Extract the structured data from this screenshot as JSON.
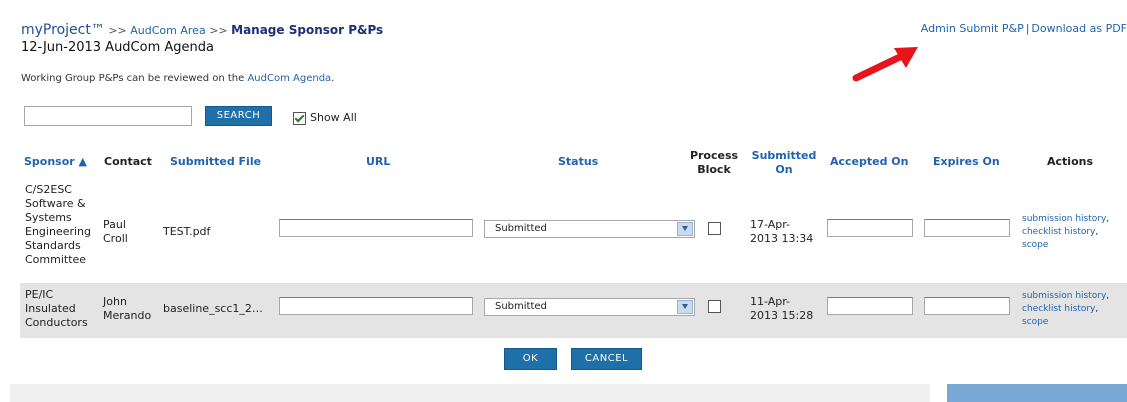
{
  "header": {
    "brand": "myProject™",
    "sep1": ">>",
    "area_link": "AudCom Area",
    "sep2": ">>",
    "current": "Manage Sponsor P&Ps",
    "agenda_title": "12-Jun-2013 AudCom Agenda",
    "admin_submit": "Admin Submit P&P",
    "divider": "|",
    "download_pdf": "Download as PDF"
  },
  "info": {
    "prefix": "Working Group P&Ps can be reviewed on the ",
    "link": "AudCom Agenda",
    "suffix": "."
  },
  "search": {
    "value": "",
    "button": "SEARCH",
    "show_all_label": "Show All",
    "show_all_checked": true
  },
  "columns": {
    "sponsor": "Sponsor ▲",
    "contact": "Contact",
    "submitted_file": "Submitted File",
    "url": "URL",
    "status": "Status",
    "process_block_1": "Process",
    "process_block_2": "Block",
    "submitted_on_1": "Submitted",
    "submitted_on_2": "On",
    "accepted_on": "Accepted On",
    "expires_on": "Expires On",
    "actions": "Actions"
  },
  "rows": [
    {
      "sponsor": [
        "C/S2ESC",
        "Software &",
        "Systems",
        "Engineering",
        "Standards",
        "Committee"
      ],
      "contact": [
        "Paul",
        "Croll"
      ],
      "file": "TEST.pdf",
      "url": "",
      "status": "Submitted",
      "process_block": false,
      "submitted_on": [
        "17-Apr-",
        "2013 13:34"
      ],
      "accepted_on": "",
      "expires_on": "",
      "actions": [
        "submission history",
        "checklist history",
        "scope"
      ]
    },
    {
      "sponsor": [
        "PE/IC",
        "Insulated",
        "Conductors"
      ],
      "contact": [
        "John",
        "Merando"
      ],
      "file": "baseline_scc1_2…",
      "url": "",
      "status": "Submitted",
      "process_block": false,
      "submitted_on": [
        "11-Apr-",
        "2013 15:28"
      ],
      "accepted_on": "",
      "expires_on": "",
      "actions": [
        "submission history",
        "checklist history",
        "scope"
      ]
    }
  ],
  "buttons": {
    "ok": "OK",
    "cancel": "CANCEL"
  },
  "colors": {
    "link": "#1f63b0",
    "button": "#1f6fa8",
    "row_alt": "#e4e4e4",
    "arrow": "#e8141b"
  },
  "icons": {
    "arrow": "red-arrow-icon",
    "dropdown": "chevron-down-icon",
    "checkbox": "checkbox-icon"
  }
}
